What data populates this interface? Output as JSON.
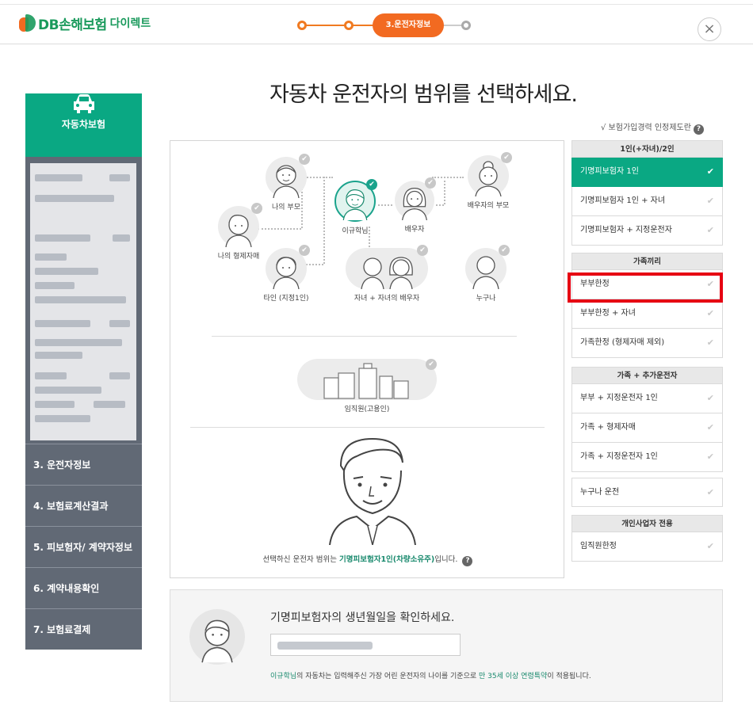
{
  "header": {
    "brand": "DB손해보험",
    "brand_sub": "다이렉트",
    "active_step": "3.운전자정보",
    "close_symbol": "×"
  },
  "sidebar": {
    "active_label": "자동차보험",
    "items": [
      {
        "label": "3. 운전자정보"
      },
      {
        "label": "4. 보험료계산결과"
      },
      {
        "label": "5. 피보험자/ 계약자정보"
      },
      {
        "label": "6. 계약내용확인"
      },
      {
        "label": "7. 보험료결제"
      }
    ]
  },
  "main": {
    "title": "자동차 운전자의 범위를 선택하세요.",
    "note": "√ 보험가입경력 인정제도란",
    "people": {
      "my_parents": "나의 부모",
      "insured": "이규학님",
      "spouse": "배우자",
      "spouse_parents": "배우자의 부모",
      "siblings": "나의 형제자매",
      "other": "타인 (지정1인)",
      "children": "자녀 + 자녀의 배우자",
      "anyone": "누구나",
      "employees": "임직원(고용인)"
    },
    "bottom_note_prefix": "선택하신 운전자 범위는",
    "bottom_note_highlight": "기명피보험자1인(차량소유주)",
    "bottom_note_suffix": "입니다."
  },
  "options": {
    "group1": {
      "header": "1인(+자녀)/2인",
      "items": [
        "기명피보험자 1인",
        "기명피보험자 1인 + 자녀",
        "기명피보험자 + 지정운전자"
      ]
    },
    "group2": {
      "header": "가족끼리",
      "items": [
        "부부한정",
        "부부한정 + 자녀",
        "가족한정 (형제자매 제외)"
      ]
    },
    "group3": {
      "header": "가족 + 추가운전자",
      "items": [
        "부부 + 지정운전자 1인",
        "가족 + 형제자매",
        "가족 + 지정운전자 1인"
      ]
    },
    "anyone": "누구나 운전",
    "group4": {
      "header": "개인사업자 전용",
      "items": [
        "임직원한정"
      ]
    },
    "check_symbol": "✔"
  },
  "birthday": {
    "title": "기명피보험자의 생년월일을 확인하세요.",
    "note_name": "이규학님",
    "note_middle": "의 자동차는 입력해주신 가장 어린 운전자의 나이를 기준으로",
    "note_highlight": "만 35세 이상 연령특약",
    "note_suffix": "이 적용됩니다."
  }
}
